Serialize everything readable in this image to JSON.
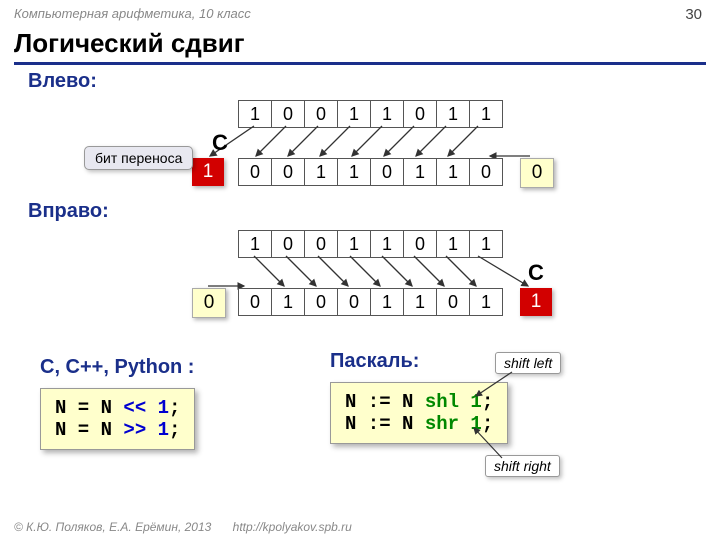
{
  "header": "Компьютерная арифметика, 10 класс",
  "page": "30",
  "title": "Логический сдвиг",
  "left_label": "Влево:",
  "right_label": "Вправо:",
  "bits_top": [
    "1",
    "0",
    "0",
    "1",
    "1",
    "0",
    "1",
    "1"
  ],
  "bits_left_result": [
    "0",
    "0",
    "1",
    "1",
    "0",
    "1",
    "1",
    "0"
  ],
  "bits_right_result": [
    "0",
    "1",
    "0",
    "0",
    "1",
    "1",
    "0",
    "1"
  ],
  "carry_left": "1",
  "fill_left": "0",
  "fill_right": "0",
  "carry_right": "1",
  "c_label": "C",
  "callout_carry": "бит переноса",
  "lang_c": "C, C++, Python :",
  "lang_pascal": "Паскаль:",
  "code_c_l1a": "N = N ",
  "code_c_l1b": "<< 1",
  "code_c_l1c": ";",
  "code_c_l2a": "N = N ",
  "code_c_l2b": ">> 1",
  "code_c_l2c": ";",
  "code_p_l1a": "N := N ",
  "code_p_l1b": "shl 1",
  "code_p_l1c": ";",
  "code_p_l2a": "N := N ",
  "code_p_l2b": "shr 1",
  "code_p_l2c": ";",
  "hint_shl": "shift left",
  "hint_shr": "shift right",
  "footer_copyright": "© К.Ю. Поляков, Е.А. Ерёмин, 2013",
  "footer_url": "http://kpolyakov.spb.ru"
}
